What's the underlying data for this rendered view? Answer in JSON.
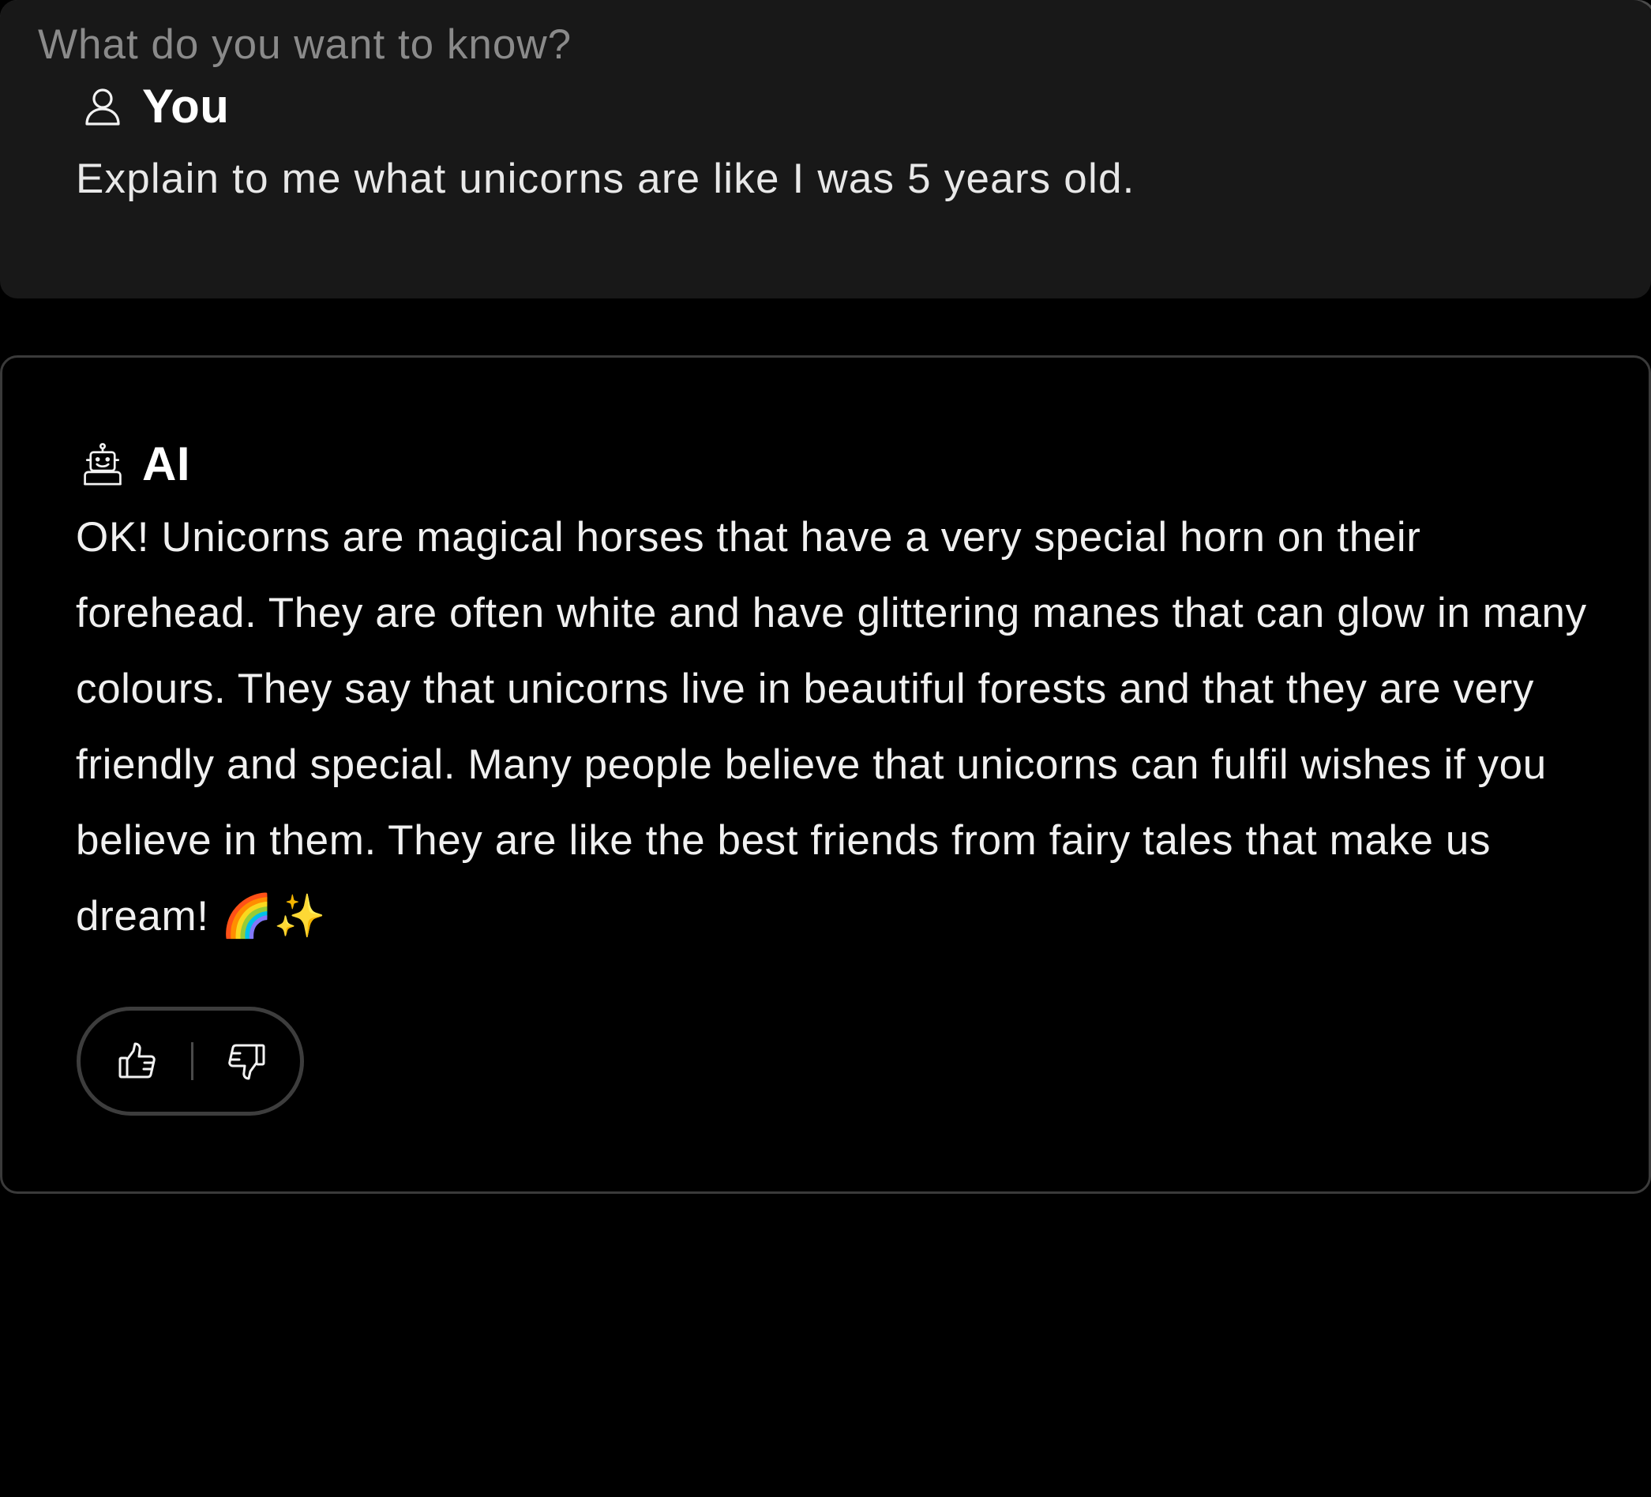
{
  "user_message": {
    "author": "You",
    "icon": "user-icon",
    "text": "Explain to me what unicorns are like I was 5 years old."
  },
  "ai_message": {
    "author": "AI",
    "icon": "robot-icon",
    "text": "OK! Unicorns are magical horses that have a very special horn on their forehead. They are often white and have glittering manes that can glow in many colours. They say that unicorns live in beautiful forests and that they are very friendly and special. Many people believe that unicorns can fulfil wishes if you believe in them. They are like the best friends from fairy tales that make us dream! 🌈✨",
    "feedback": {
      "like_icon": "thumbs-up-icon",
      "dislike_icon": "thumbs-down-icon"
    }
  },
  "composer": {
    "placeholder": "What do you want to know?",
    "value": ""
  },
  "colors": {
    "background": "#000000",
    "user_card": "#181818",
    "ai_card_border": "#3a3a3a",
    "input_bg": "#161616",
    "text": "#f2f2f2",
    "placeholder": "#8a8a8a"
  }
}
